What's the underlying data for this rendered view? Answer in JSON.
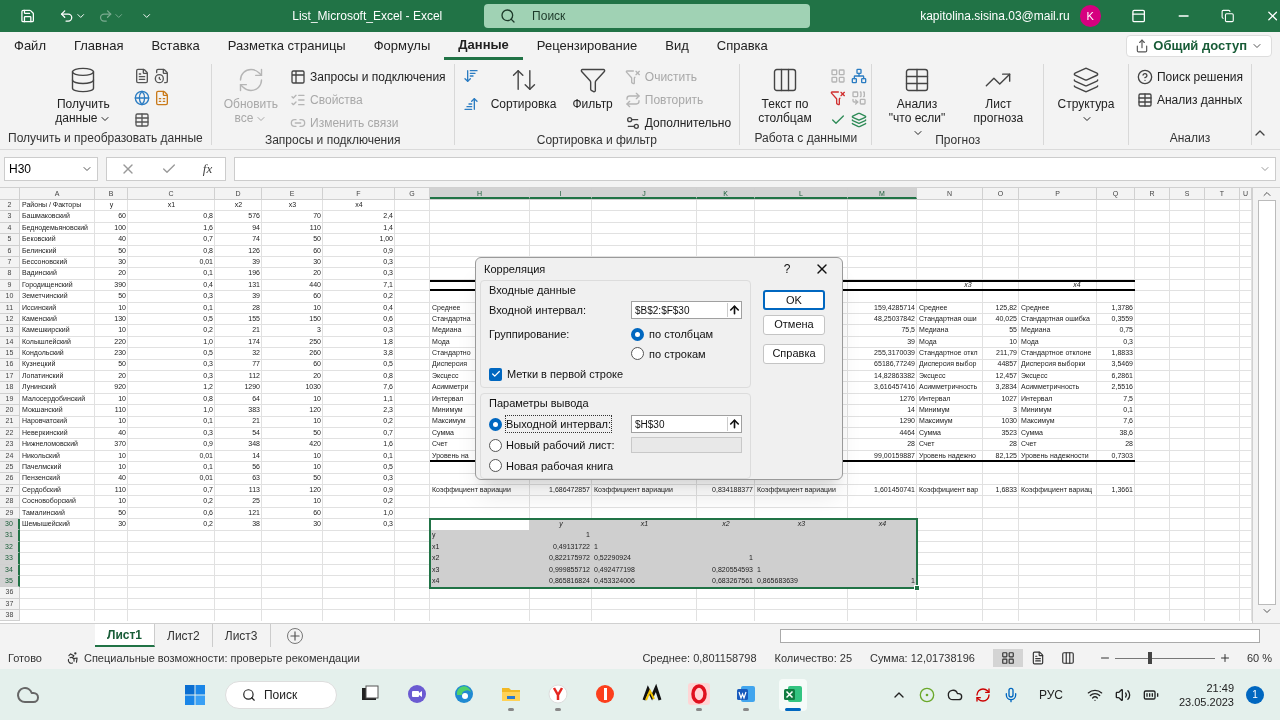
{
  "title_bar": {
    "title": "List_Microsoft_Excel - Excel",
    "search_placeholder": "Поиск",
    "account": "kapitolina.sisina.03@mail.ru",
    "avatar": "K"
  },
  "tabs": [
    {
      "label": "Файл",
      "selected": false
    },
    {
      "label": "Главная",
      "selected": false
    },
    {
      "label": "Вставка",
      "selected": false
    },
    {
      "label": "Разметка страницы",
      "selected": false
    },
    {
      "label": "Формулы",
      "selected": false
    },
    {
      "label": "Данные",
      "selected": true
    },
    {
      "label": "Рецензирование",
      "selected": false
    },
    {
      "label": "Вид",
      "selected": false
    },
    {
      "label": "Справка",
      "selected": false
    }
  ],
  "share_button": "Общий доступ",
  "ribbon": {
    "groups": [
      {
        "label": "Получить и преобразовать данные",
        "items": [
          {
            "kind": "large",
            "label": "Получить данные",
            "dropdown": true,
            "disabled": false
          },
          {
            "kind": "icon_grid",
            "disabled": false
          }
        ]
      },
      {
        "label": "Запросы и подключения",
        "items": [
          {
            "kind": "large",
            "label": "Обновить все",
            "dropdown": true,
            "disabled": true
          },
          {
            "kind": "small",
            "label": "Запросы и подключения",
            "disabled": false
          },
          {
            "kind": "small",
            "label": "Свойства",
            "disabled": true
          },
          {
            "kind": "small",
            "label": "Изменить связи",
            "disabled": true
          }
        ]
      },
      {
        "label": "Сортировка и фильтр",
        "items": [
          {
            "kind": "icon_grid",
            "disabled": false
          },
          {
            "kind": "large",
            "label": "Сортировка",
            "dropdown": false,
            "disabled": false
          },
          {
            "kind": "large",
            "label": "Фильтр",
            "dropdown": false,
            "disabled": false
          },
          {
            "kind": "small",
            "label": "Очистить",
            "disabled": true
          },
          {
            "kind": "small",
            "label": "Повторить",
            "disabled": true
          },
          {
            "kind": "small",
            "label": "Дополнительно",
            "disabled": false
          }
        ]
      },
      {
        "label": "Работа с данными",
        "items": [
          {
            "kind": "large",
            "label": "Текст по столбцам",
            "dropdown": false,
            "disabled": false
          },
          {
            "kind": "icon_grid",
            "disabled": false
          }
        ]
      },
      {
        "label": "Прогноз",
        "items": [
          {
            "kind": "large",
            "label": "Анализ \"что если\"",
            "dropdown": true,
            "disabled": false
          },
          {
            "kind": "large",
            "label": "Лист прогноза",
            "dropdown": false,
            "disabled": false
          }
        ]
      },
      {
        "items": [
          {
            "kind": "large",
            "label": "Структура",
            "dropdown": true,
            "disabled": false
          }
        ]
      },
      {
        "label": "Анализ",
        "items": [
          {
            "kind": "small",
            "label": "Поиск решения",
            "disabled": false
          },
          {
            "kind": "small",
            "label": "Анализ данных",
            "disabled": false
          }
        ]
      }
    ]
  },
  "formula_bar": {
    "name_box": "H30",
    "function_label": "fx"
  },
  "sheet": {
    "columns": [
      {
        "letter": "A",
        "selected": false
      },
      {
        "letter": "B",
        "selected": false
      },
      {
        "letter": "C",
        "selected": false
      },
      {
        "letter": "D",
        "selected": false
      },
      {
        "letter": "E",
        "selected": false
      },
      {
        "letter": "F",
        "selected": false
      },
      {
        "letter": "G",
        "selected": false
      },
      {
        "letter": "H",
        "selected": true
      },
      {
        "letter": "I",
        "selected": true
      },
      {
        "letter": "J",
        "selected": true
      },
      {
        "letter": "K",
        "selected": true
      },
      {
        "letter": "L",
        "selected": true
      },
      {
        "letter": "M",
        "selected": true
      },
      {
        "letter": "N",
        "selected": false
      },
      {
        "letter": "O",
        "selected": false
      },
      {
        "letter": "P",
        "selected": false
      },
      {
        "letter": "Q",
        "selected": false
      },
      {
        "letter": "R",
        "selected": false
      },
      {
        "letter": "S",
        "selected": false
      },
      {
        "letter": "T",
        "selected": false
      },
      {
        "letter": "U",
        "selected": false
      }
    ],
    "rows": [
      {
        "number": "2",
        "kind": "header",
        "selected": false,
        "cells": {
          "A": "Районы / Факторы",
          "B": "y",
          "C": "x1",
          "D": "x2",
          "E": "x3",
          "F": "x4"
        }
      },
      {
        "number": "3",
        "kind": "data",
        "selected": false,
        "cells": {
          "A": "Башмаковский",
          "B": "60",
          "C": "0,8",
          "D": "576",
          "E": "70",
          "F": "2,4"
        }
      },
      {
        "number": "4",
        "kind": "data",
        "selected": false,
        "cells": {
          "A": "Беднодемьяновский",
          "B": "100",
          "C": "1,6",
          "D": "94",
          "E": "110",
          "F": "1,4"
        }
      },
      {
        "number": "5",
        "kind": "data",
        "selected": false,
        "cells": {
          "A": "Бековский",
          "B": "40",
          "C": "0,7",
          "D": "74",
          "E": "50",
          "F": "1,00"
        }
      },
      {
        "number": "6",
        "kind": "data",
        "selected": false,
        "cells": {
          "A": "Белинский",
          "B": "50",
          "C": "0,8",
          "D": "126",
          "E": "60",
          "F": "0,9"
        }
      },
      {
        "number": "7",
        "kind": "data",
        "selected": false,
        "cells": {
          "A": "Бессоновский",
          "B": "30",
          "C": "0,01",
          "D": "39",
          "E": "30",
          "F": "0,3"
        }
      },
      {
        "number": "8",
        "kind": "data",
        "selected": false,
        "cells": {
          "A": "Вадинский",
          "B": "20",
          "C": "0,1",
          "D": "196",
          "E": "20",
          "F": "0,3"
        }
      },
      {
        "number": "9",
        "kind": "section_top",
        "selected": false,
        "cells": {
          "A": "Городищенский",
          "B": "390",
          "C": "0,4",
          "D": "131",
          "E": "440",
          "F": "7,1",
          "N": "x3",
          "P": "x4"
        }
      },
      {
        "number": "10",
        "kind": "data",
        "selected": false,
        "cells": {
          "A": "Земетчинский",
          "B": "50",
          "C": "0,3",
          "D": "39",
          "E": "60",
          "F": "0,2"
        }
      },
      {
        "number": "11",
        "kind": "data",
        "selected": false,
        "cells": {
          "A": "Иссинский",
          "B": "10",
          "C": "0,1",
          "D": "28",
          "E": "10",
          "F": "0,4",
          "H": "Среднее",
          "M": "159,4285714",
          "N": "Среднее",
          "O": "125,82",
          "P": "Среднее",
          "Q": "1,3786"
        }
      },
      {
        "number": "12",
        "kind": "data",
        "selected": false,
        "cells": {
          "A": "Каменский",
          "B": "130",
          "C": "0,5",
          "D": "155",
          "E": "150",
          "F": "0,6",
          "H": "Стандартна",
          "M": "48,25037842",
          "N": "Стандартная оши",
          "O": "40,025",
          "P": "Стандартная ошибка",
          "Q": "0,3559"
        }
      },
      {
        "number": "13",
        "kind": "data",
        "selected": false,
        "cells": {
          "A": "Камешкирский",
          "B": "10",
          "C": "0,2",
          "D": "21",
          "E": "3",
          "F": "0,3",
          "H": "Медиана",
          "M": "75,5",
          "N": "Медиана",
          "O": "55",
          "P": "Медиана",
          "Q": "0,75"
        }
      },
      {
        "number": "14",
        "kind": "data",
        "selected": false,
        "cells": {
          "A": "Колышлейский",
          "B": "220",
          "C": "1,0",
          "D": "174",
          "E": "250",
          "F": "1,8",
          "H": "Мода",
          "M": "39",
          "N": "Мода",
          "O": "10",
          "P": "Мода",
          "Q": "0,3"
        }
      },
      {
        "number": "15",
        "kind": "data",
        "selected": false,
        "cells": {
          "A": "Кондольский",
          "B": "230",
          "C": "0,5",
          "D": "32",
          "E": "260",
          "F": "3,8",
          "H": "Стандартно",
          "M": "255,3170039",
          "N": "Стандартное откл",
          "O": "211,79",
          "P": "Стандартное отклоне",
          "Q": "1,8833"
        }
      },
      {
        "number": "16",
        "kind": "data",
        "selected": false,
        "cells": {
          "A": "Кузнецкий",
          "B": "50",
          "C": "0,3",
          "D": "77",
          "E": "60",
          "F": "0,5",
          "H": "Дисперсия",
          "M": "65186,77249",
          "N": "Дисперсия выбор",
          "O": "44857",
          "P": "Дисперсия выборки",
          "Q": "3,5469"
        }
      },
      {
        "number": "17",
        "kind": "data",
        "selected": false,
        "cells": {
          "A": "Лопатинский",
          "B": "20",
          "C": "0,3",
          "D": "112",
          "E": "20",
          "F": "0,8",
          "H": "Эксцесс",
          "M": "14,82863382",
          "N": "Эксцесс",
          "O": "12,457",
          "P": "Эксцесс",
          "Q": "6,2861"
        }
      },
      {
        "number": "18",
        "kind": "data",
        "selected": false,
        "cells": {
          "A": "Лунинский",
          "B": "920",
          "C": "1,2",
          "D": "1290",
          "E": "1030",
          "F": "7,6",
          "H": "Асимметри",
          "M": "3,616457416",
          "N": "Асимметричность",
          "O": "3,2834",
          "P": "Асимметричность",
          "Q": "2,5516"
        }
      },
      {
        "number": "19",
        "kind": "data",
        "selected": false,
        "cells": {
          "A": "Малосердобинский",
          "B": "10",
          "C": "0,8",
          "D": "64",
          "E": "10",
          "F": "1,1",
          "H": "Интервал",
          "M": "1276",
          "N": "Интервал",
          "O": "1027",
          "P": "Интервал",
          "Q": "7,5"
        }
      },
      {
        "number": "20",
        "kind": "data",
        "selected": false,
        "cells": {
          "A": "Мокшанский",
          "B": "110",
          "C": "1,0",
          "D": "383",
          "E": "120",
          "F": "2,3",
          "H": "Минимум",
          "M": "14",
          "N": "Минимум",
          "O": "3",
          "P": "Минимум",
          "Q": "0,1"
        }
      },
      {
        "number": "21",
        "kind": "data",
        "selected": false,
        "cells": {
          "A": "Наровчатский",
          "B": "10",
          "C": "0,1",
          "D": "21",
          "E": "10",
          "F": "0,2",
          "H": "Максимум",
          "M": "1290",
          "N": "Максимум",
          "O": "1030",
          "P": "Максимум",
          "Q": "7,6"
        }
      },
      {
        "number": "22",
        "kind": "data",
        "selected": false,
        "cells": {
          "A": "Неверкинский",
          "B": "40",
          "C": "0,3",
          "D": "54",
          "E": "50",
          "F": "0,7",
          "H": "Сумма",
          "M": "4464",
          "N": "Сумма",
          "O": "3523",
          "P": "Сумма",
          "Q": "38,6"
        }
      },
      {
        "number": "23",
        "kind": "data",
        "selected": false,
        "cells": {
          "A": "Нижнеломовский",
          "B": "370",
          "C": "0,9",
          "D": "348",
          "E": "420",
          "F": "1,6",
          "H": "Счет",
          "M": "28",
          "N": "Счет",
          "O": "28",
          "P": "Счет",
          "Q": "28"
        }
      },
      {
        "number": "24",
        "kind": "section_end",
        "selected": false,
        "cells": {
          "A": "Никольский",
          "B": "10",
          "C": "0,01",
          "D": "14",
          "E": "10",
          "F": "0,1",
          "H": "Уровень на",
          "M": "99,00159887",
          "N": "Уровень надежно",
          "O": "82,125",
          "P": "Уровень надежности",
          "Q": "0,7303"
        }
      },
      {
        "number": "25",
        "kind": "data",
        "selected": false,
        "cells": {
          "A": "Пачелмский",
          "B": "10",
          "C": "0,1",
          "D": "56",
          "E": "10",
          "F": "0,5"
        }
      },
      {
        "number": "26",
        "kind": "data",
        "selected": false,
        "cells": {
          "A": "Пензенский",
          "B": "40",
          "C": "0,01",
          "D": "63",
          "E": "50",
          "F": "0,3"
        }
      },
      {
        "number": "27",
        "kind": "data",
        "selected": false,
        "cells": {
          "A": "Сердобский",
          "B": "110",
          "C": "0,7",
          "D": "113",
          "E": "120",
          "F": "0,9",
          "H": "Коэффициент вариации",
          "I": "1,686472857",
          "J": "Коэффициент вариации",
          "K": "0,834188377",
          "L": "Коэффициент вариации",
          "M": "1,601450741",
          "N": "Коэффициент вар",
          "O": "1,6833",
          "P": "Коэффициент вариац",
          "Q": "1,3661"
        }
      },
      {
        "number": "28",
        "kind": "data",
        "selected": false,
        "cells": {
          "A": "Сосновоборский",
          "B": "10",
          "C": "0,2",
          "D": "25",
          "E": "10",
          "F": "0,2"
        }
      },
      {
        "number": "29",
        "kind": "data",
        "selected": false,
        "cells": {
          "A": "Тамалинский",
          "B": "50",
          "C": "0,6",
          "D": "121",
          "E": "60",
          "F": "1,0"
        }
      },
      {
        "number": "30",
        "kind": "corr_header",
        "selected": true,
        "cells": {
          "A": "Шемышейский",
          "B": "30",
          "C": "0,2",
          "D": "38",
          "E": "30",
          "F": "0,3",
          "I": "y",
          "J": "x1",
          "K": "x2",
          "L": "x3",
          "M": "x4"
        }
      },
      {
        "number": "31",
        "kind": "data",
        "selected": true,
        "cells": {
          "H": "y",
          "I": "1"
        }
      },
      {
        "number": "32",
        "kind": "data",
        "selected": true,
        "cells": {
          "H": "x1",
          "I": "0,49131722",
          "J": "1"
        }
      },
      {
        "number": "33",
        "kind": "data",
        "selected": true,
        "cells": {
          "H": "x2",
          "I": "0,822175972",
          "J": "0,52290924",
          "K": "1"
        }
      },
      {
        "number": "34",
        "kind": "data",
        "selected": true,
        "cells": {
          "H": "x3",
          "I": "0,999855712",
          "J": "0,492477198",
          "K": "0,820554593",
          "L": "1"
        }
      },
      {
        "number": "35",
        "kind": "data",
        "selected": true,
        "cells": {
          "H": "x4",
          "I": "0,865816824",
          "J": "0,453324006",
          "K": "0,683267561",
          "L": "0,865683639",
          "M": "1"
        }
      },
      {
        "number": "36",
        "kind": "data",
        "selected": false
      },
      {
        "number": "37",
        "kind": "data",
        "selected": false
      },
      {
        "number": "38",
        "kind": "data",
        "selected": false
      }
    ]
  },
  "dialog": {
    "title": "Корреляция",
    "help": "?",
    "input_group": {
      "legend": "Входные данные",
      "range_label": "Входной интервал:",
      "range_value": "$B$2:$F$30",
      "grouping_label": "Группирование:",
      "grouping": [
        {
          "label": "по столбцам",
          "selected": true
        },
        {
          "label": "по строкам",
          "selected": false
        }
      ],
      "labels_checkbox": {
        "label": "Метки в первой строке",
        "checked": true
      }
    },
    "output_group": {
      "legend": "Параметры вывода",
      "options": [
        {
          "kind": "field",
          "label": "Выходной интервал:",
          "selected": true,
          "value": "$H$30",
          "field_disabled": false
        },
        {
          "kind": "field",
          "label": "Новый рабочий лист:",
          "selected": false,
          "field_disabled": true
        },
        {
          "kind": "plain",
          "label": "Новая рабочая книга",
          "selected": false
        }
      ]
    },
    "buttons": [
      {
        "label": "OK",
        "default": true
      },
      {
        "label": "Отмена",
        "default": false
      },
      {
        "label": "Справка",
        "default": false
      }
    ]
  },
  "sheet_tabs": [
    {
      "label": "Лист1",
      "selected": true
    },
    {
      "label": "Лист2",
      "selected": false
    },
    {
      "label": "Лист3",
      "selected": false
    }
  ],
  "status_bar": {
    "ready": "Готово",
    "accessibility": "Специальные возможности: проверьте рекомендации",
    "stats": [
      "Среднее: 0,801158798",
      "Количество: 25",
      "Сумма: 12,01738196"
    ],
    "views": [
      {
        "kind": "normal",
        "selected": true
      },
      {
        "kind": "page_layout",
        "selected": false
      },
      {
        "kind": "page_break",
        "selected": false
      }
    ],
    "zoom": {
      "level": 0.33,
      "label": "60 %"
    }
  },
  "taskbar": {
    "search": "Поиск",
    "apps": [
      {
        "kind": "taskview",
        "running": false,
        "selected": false
      },
      {
        "kind": "chat",
        "running": false,
        "selected": false
      },
      {
        "kind": "edge",
        "running": false,
        "selected": false
      },
      {
        "kind": "explorer",
        "running": true,
        "selected": false
      },
      {
        "kind": "yandex_browser",
        "running": true,
        "selected": false
      },
      {
        "kind": "yandex",
        "running": false,
        "selected": false
      },
      {
        "kind": "miro",
        "running": false,
        "selected": false
      },
      {
        "kind": "opera",
        "running": true,
        "selected": false
      },
      {
        "kind": "word",
        "running": true,
        "selected": false
      },
      {
        "kind": "excel",
        "running": true,
        "selected": true
      }
    ],
    "language": "РУС",
    "time": "21:49",
    "date": "23.05.2023",
    "notifications": "1"
  }
}
